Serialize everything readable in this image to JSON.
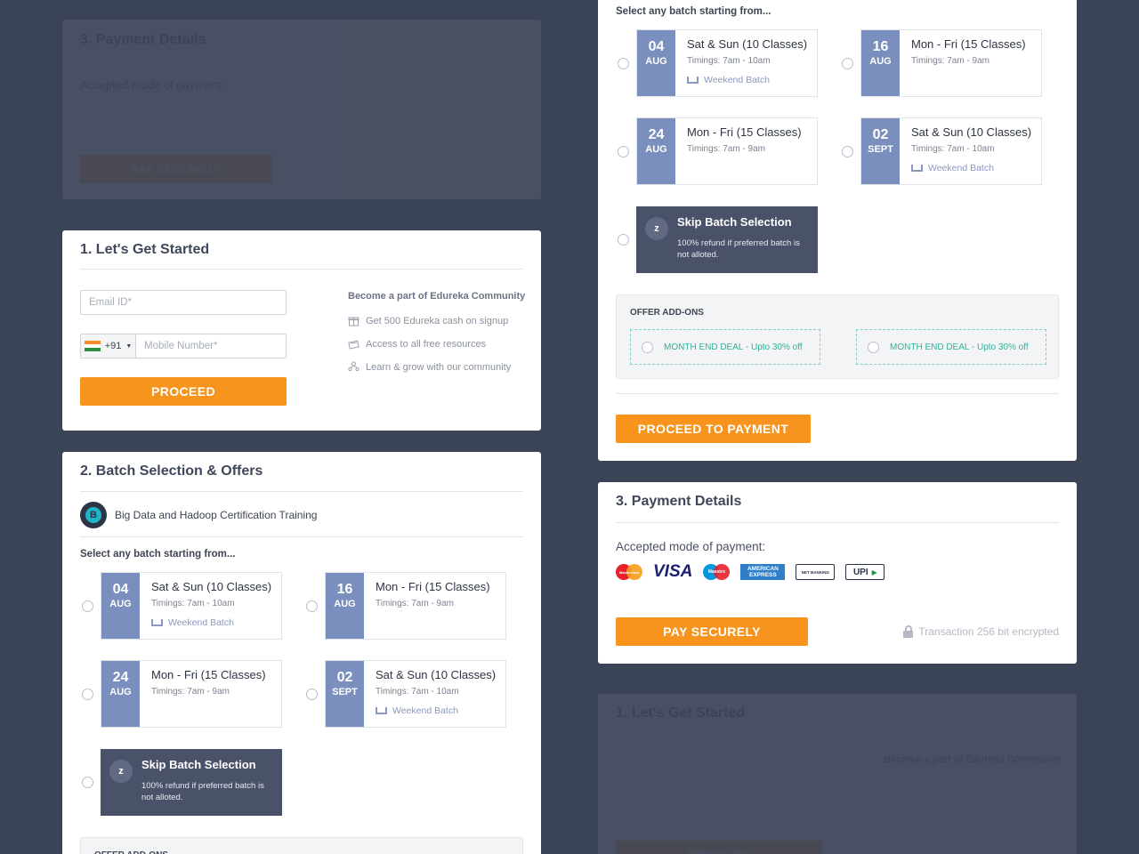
{
  "colors": {
    "background": "#3b4357",
    "accent": "#f7941d",
    "date_tile": "#7a8fbd",
    "skip_tile": "#4a5269",
    "offer_text": "#2bb39b"
  },
  "login": {
    "title": "1. Let's Get Started",
    "email_placeholder": "Email ID*",
    "country_code": "+91",
    "mobile_placeholder": "Mobile Number*",
    "proceed_label": "PROCEED",
    "community_heading": "Become a part of Edureka Community",
    "perks": [
      "Get 500 Edureka cash on signup",
      "Access to all free resources",
      "Learn & grow with our community"
    ]
  },
  "batch_section": {
    "title": "2. Batch Selection & Offers",
    "course_name": "Big Data and Hadoop Certification Training",
    "select_label": "Select any batch starting from...",
    "batches": [
      {
        "day": "04",
        "month": "AUG",
        "title": "Sat & Sun (10 Classes)",
        "timings": "Timings: 7am - 10am",
        "weekend": "Weekend Batch"
      },
      {
        "day": "16",
        "month": "AUG",
        "title": "Mon - Fri (15 Classes)",
        "timings": "Timings: 7am - 9am",
        "weekend": ""
      },
      {
        "day": "24",
        "month": "AUG",
        "title": "Mon - Fri (15 Classes)",
        "timings": "Timings: 7am - 9am",
        "weekend": ""
      },
      {
        "day": "02",
        "month": "SEPT",
        "title": "Sat & Sun (10 Classes)",
        "timings": "Timings: 7am - 10am",
        "weekend": "Weekend Batch"
      }
    ],
    "skip": {
      "title": "Skip Batch Selection",
      "description": "100% refund if preferred batch is not alloted."
    },
    "offers_heading": "OFFER ADD-ONS",
    "offers": [
      "MONTH END DEAL - Upto 30% off",
      "MONTH END DEAL - Upto 30% off"
    ],
    "proceed_label": "PROCEED TO PAYMENT"
  },
  "payment": {
    "title": "3. Payment Details",
    "accepted_label": "Accepted mode of payment:",
    "methods": [
      "MasterCard",
      "VISA",
      "Maestro",
      "AMERICAN EXPRESS",
      "NET BANKING",
      "UPI"
    ],
    "pay_label": "PAY SECURELY",
    "encryption_note": "Transaction 256 bit encrypted"
  }
}
